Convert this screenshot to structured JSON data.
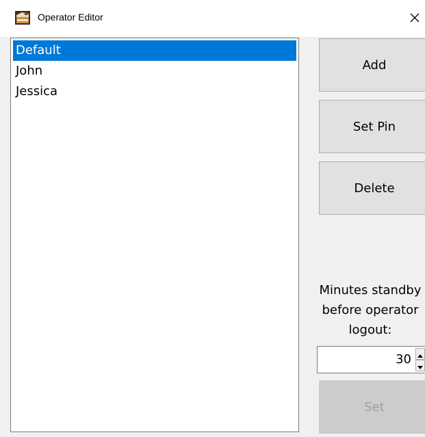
{
  "window": {
    "title": "Operator Editor",
    "app_icon": "app-icon",
    "close_icon": "close-icon"
  },
  "operators": {
    "items": [
      {
        "label": "Default",
        "selected": true
      },
      {
        "label": "John",
        "selected": false
      },
      {
        "label": "Jessica",
        "selected": false
      }
    ]
  },
  "actions": {
    "add_label": "Add",
    "set_pin_label": "Set Pin",
    "delete_label": "Delete"
  },
  "standby": {
    "label": "Minutes standby\nbefore operator\nlogout:",
    "value": "30",
    "set_label": "Set",
    "set_enabled": false
  },
  "colors": {
    "selection": "#0078d7",
    "button_face": "#e1e1e1",
    "button_disabled": "#cccccc"
  }
}
